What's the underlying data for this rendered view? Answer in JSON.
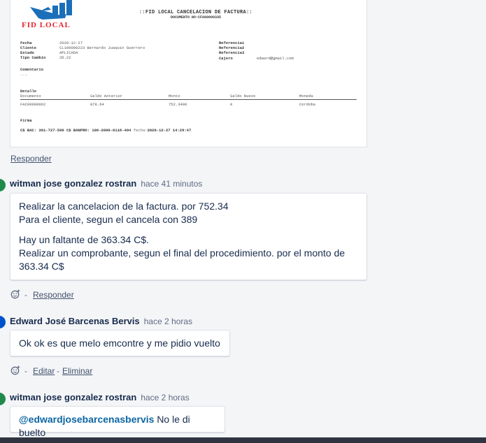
{
  "receipt": {
    "logo_text": "FID LOCAL",
    "title": "::FID LOCAL CANCELACION DE FACTURA::",
    "subtitle": "DOCUMENTO NO:CFA00000335",
    "labels": {
      "fecha": "Fecha",
      "cliente": "Cliente",
      "estado": "Estado",
      "tipo_cambio": "Tipo Cambio",
      "ref1": "Referencia1",
      "ref2": "Referencia2",
      "ref3": "Referencia3",
      "cajero": "Cajero",
      "comentario": "Comentario",
      "detalle": "Detalle",
      "firma": "Firma"
    },
    "values": {
      "fecha": "2020-12-27",
      "cliente": "CL100000223 Bernardo Juaquin Guerrero",
      "estado": "APLICADA",
      "tipo_cambio": "35.22",
      "cajero": "edward@gmail.com",
      "comentario": "..."
    },
    "table": {
      "headers": [
        "Documento",
        "Saldo Anterior",
        "Monto",
        "Saldo Nuevo",
        "Moneda"
      ],
      "row": [
        "FAC00000962",
        "878.64",
        "752.3400",
        "0",
        "Cordoba"
      ]
    },
    "footer_bank": "C$ BAC: 361-727-506  C$ BANPRO: 100-2000-0118-404",
    "footer_fecha_label": "fecha:",
    "footer_fecha": "2020-12-27 14:29:47"
  },
  "reply_label": "Responder",
  "comments": [
    {
      "author": "witman jose gonzalez rostran",
      "time": "hace 41 minutos",
      "lines": [
        "Realizar la cancelacion de la factura. por 752.34",
        "Para el cliente, segun el cancela con 389",
        "Hay un faltante de 363.34 C$.",
        "Realizar un comprobante, segun el final del procedimiento. por el monto de 363.34 C$"
      ],
      "action": "Responder",
      "avatar_color": "#1f8a4c"
    },
    {
      "author": "Edward José Barcenas Bervis",
      "time": "hace 2 horas",
      "text": "Ok ok es que melo emcontre y me pidio vuelto",
      "action_edit": "Editar",
      "action_delete": "Eliminar",
      "avatar_color": "#0052cc"
    },
    {
      "author": "witman jose gonzalez rostran",
      "time": "hace 2 horas",
      "mention": "@edwardjosebarcenasbervis",
      "text": "No le di buelto",
      "avatar_color": "#1f8a4c"
    }
  ],
  "separator": "-"
}
